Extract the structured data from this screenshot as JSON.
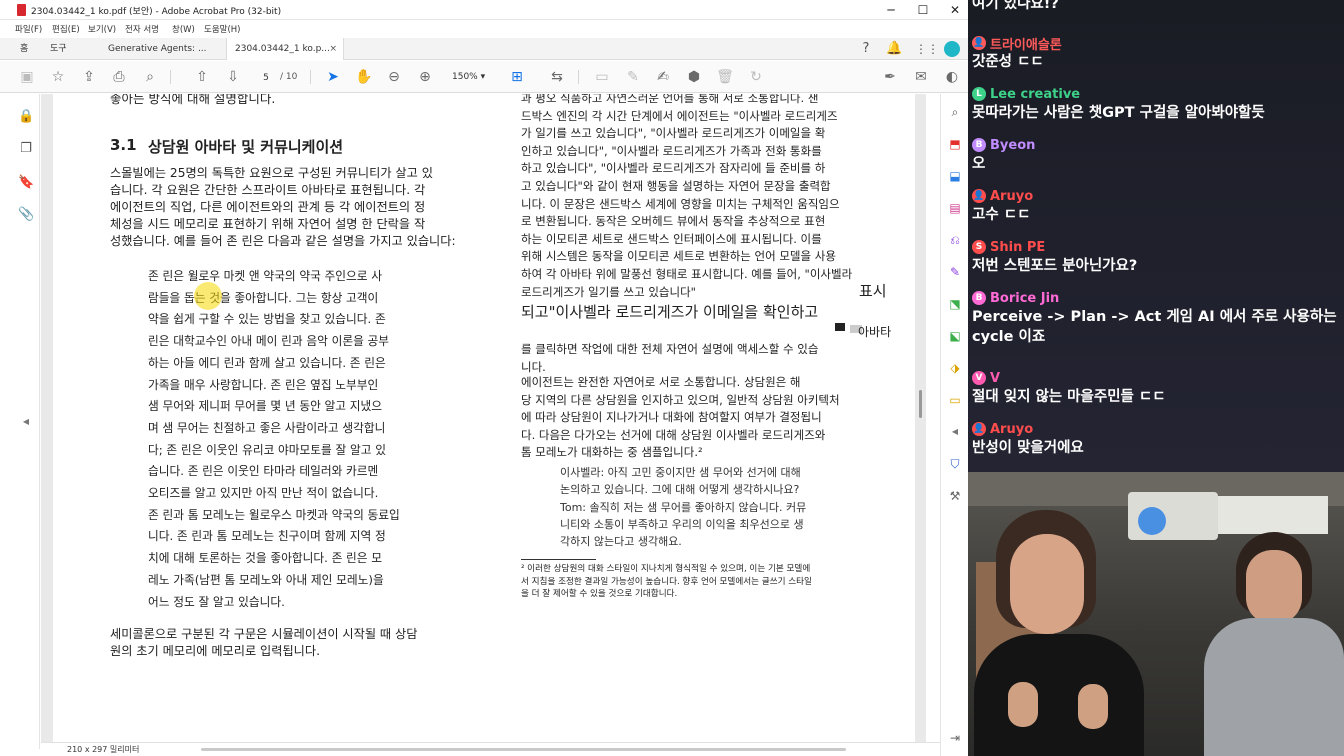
{
  "window": {
    "title": "2304.03442_1 ko.pdf (보안) - Adobe Acrobat Pro (32-bit)",
    "minimize": "─",
    "maximize": "☐",
    "close": "✕"
  },
  "menu": [
    "파일(F)",
    "편집(E)",
    "보기(V)",
    "전자 서명",
    "창(W)",
    "도움말(H)"
  ],
  "tabs": {
    "home": "홈",
    "tools": "도구",
    "doc1": "Generative Agents: ...",
    "doc2": "2304.03442_1 ko.p...",
    "close": "×"
  },
  "toolbar": {
    "page_current": "5",
    "page_total": "/ 10",
    "zoom": "150%"
  },
  "icons": {
    "help": "help-icon",
    "bell": "bell-icon",
    "apps": "apps-icon",
    "profile": "profile-icon"
  },
  "page": {
    "left": {
      "top_cut": "좋아는 방식에 대해 설명합니다.",
      "heading_num": "3.1",
      "heading": "상담원 아바타 및 커뮤니케이션",
      "para1": [
        "스몰빌에는 25명의 독특한 요원으로 구성된 커뮤니티가 살고 있",
        "습니다. 각 요원은 간단한 스프라이트 아바타로 표현됩니다. 각",
        "에이전트의 직업, 다른 에이전트와의 관계 등 각 에이전트의 정",
        "체성을 시드 메모리로 표현하기 위해 자연어 설명 한 단락을 작",
        "성했습니다. 예를 들어 존 린은 다음과 같은 설명을 가지고 있습니다:"
      ],
      "quote": [
        "존 린은 윌로우 마켓 앤 약국의 약국 주인으로 사",
        "람들을 돕는 것을 좋아합니다. 그는 항상 고객이",
        "약을 쉽게 구할 수 있는 방법을 찾고 있습니다. 존",
        "린은 대학교수인 아내 메이 린과 음악 이론을 공부",
        "하는 아들 에디 린과 함께 살고 있습니다. 존 린은",
        "가족을 매우 사랑합니다. 존 린은 옆집 노부부인",
        "샘 무어와 제니퍼 무어를 몇 년 동안 알고 지냈으",
        "며 샘 무어는 친절하고 좋은 사람이라고 생각합니",
        "다; 존 린은 이웃인 유리코 야마모토를 잘 알고 있",
        "습니다. 존 린은 이웃인 타마라 테일러와 카르멘",
        "오티즈를 알고 있지만 아직 만난 적이 없습니다.",
        "존 린과 톰 모레노는 윌로우스 마켓과 약국의 동료입",
        "니다. 존 린과 톰 모레노는 친구이며 함께 지역 정",
        "치에 대해 토론하는 것을 좋아합니다. 존 린은 모",
        "레노 가족(남편 톰 모레노와 아내 제인 모레노)을",
        "어느 정도 잘 알고 있습니다."
      ],
      "para2": [
        "세미콜론으로 구분된 각 구문은 시뮬레이션이 시작될 때 상담",
        "원의 초기 메모리에 메모리로 입력됩니다."
      ]
    },
    "right": {
      "para1": [
        "과 평오 식품하고 자연스러운 언어를 통해 서로 소통합니다. 샌",
        "드박스 엔진의 각 시간 단계에서 에이전트는 \"이사벨라 로드리게즈",
        "가 일기를 쓰고 있습니다\", \"이사벨라 로드리게즈가 이메일을 확",
        "인하고 있습니다\", \"이사벨라 로드리게즈가 가족과 전화 통화를",
        "하고 있습니다\", \"이사벨라 로드리게즈가 잠자리에 들 준비를 하",
        "고 있습니다\"와 같이 현재 행동을 설명하는 자연어 문장을 출력합",
        "니다. 이 문장은 샌드박스 세계에 영향을 미치는 구체적인 움직임으",
        "로 변환됩니다. 동작은 오버헤드 뷰에서 동작을 추상적으로 표현",
        "하는 이모티콘 세트로 샌드박스 인터페이스에 표시됩니다. 이를",
        "위해 시스템은 동작을 이모티콘 세트로 변환하는 언어 모델을 사용",
        "하여 각 아바타 위에 말풍선 형태로 표시합니다. 예를 들어, \"이사벨라",
        "로드리게즈가 일기를 쓰고 있습니다\""
      ],
      "big_a": "표시",
      "big_b": "되고\"이사벨라 로드리게즈가 이메일을 확인하고",
      "avatar_word": "아바타",
      "para2": [
        "를 클릭하면 작업에 대한 전체 자연어 설명에 액세스할 수 있습",
        "니다."
      ],
      "para3": [
        "  에이전트는 완전한 자연어로 서로 소통합니다. 상담원은 해",
        "당 지역의 다른 상담원을 인지하고 있으며, 일반적 상담원 아키텍처",
        "에 따라 상담원이 지나가거나 대화에 참여할지 여부가 결정됩니",
        "다. 다음은 다가오는 선거에 대해 상담원 이사벨라 로드리게즈와",
        "톰 모레노가 대화하는 중 샘플입니다.²"
      ],
      "dialog": [
        "이사벨라: 아직 고민 중이지만 샘 무어와 선거에 대해",
        "논의하고 있습니다. 그에 대해 어떻게 생각하시나요?",
        "Tom: 솔직히 저는 샘 무어를 좋아하지 않습니다. 커뮤",
        "니티와 소통이 부족하고 우리의 이익을 최우선으로 생",
        "각하지 않는다고 생각해요."
      ],
      "footnote": [
        "² 이러한 상담원의 대화 스타일이 지나치게 형식적일 수 있으며, 이는 기본 모델에",
        "서 지침을 조정한 결과일 가능성이 높습니다. 향후 언어 모델에서는 글쓰기 스타일",
        "을 더 잘 제어할 수 있을 것으로 기대합니다."
      ]
    }
  },
  "status": {
    "page_size": "210 x 297 밀리미터"
  },
  "chat": [
    {
      "user": "",
      "msg": "여기 있나요!?",
      "color": "#ff4d4d",
      "badge": ""
    },
    {
      "user": "트라이애슬론",
      "msg": "갓준성 ㄷㄷ",
      "color": "#ff5a5a",
      "badge": "👤"
    },
    {
      "user": "Lee creative",
      "msg": "못따라가는 사람은 챗GPT 구걸을 알아봐야할듯",
      "color": "#3dd18a",
      "badge": "L"
    },
    {
      "user": "Byeon",
      "msg": "오",
      "color": "#c08cff",
      "badge": "B"
    },
    {
      "user": "Aruyo",
      "msg": "고수 ㄷㄷ",
      "color": "#ff4d4d",
      "badge": "👤"
    },
    {
      "user": "Shin PE",
      "msg": "저번 스텐포드 분아닌가요?",
      "color": "#ff4d4d",
      "badge": "S"
    },
    {
      "user": "Borice Jin",
      "msg": "Perceive -> Plan -> Act 게임 AI 에서 주로 사용하는",
      "msg2": "cycle 이죠",
      "color": "#ff6ad5",
      "badge": "B"
    },
    {
      "user": "V",
      "msg": "절대 잊지 않는 마을주민들 ㄷㄷ",
      "color": "#ff5ab0",
      "badge": "V"
    },
    {
      "user": "Aruyo",
      "msg": "반성이 맞을거에요",
      "color": "#ff4d4d",
      "badge": "👤"
    }
  ]
}
